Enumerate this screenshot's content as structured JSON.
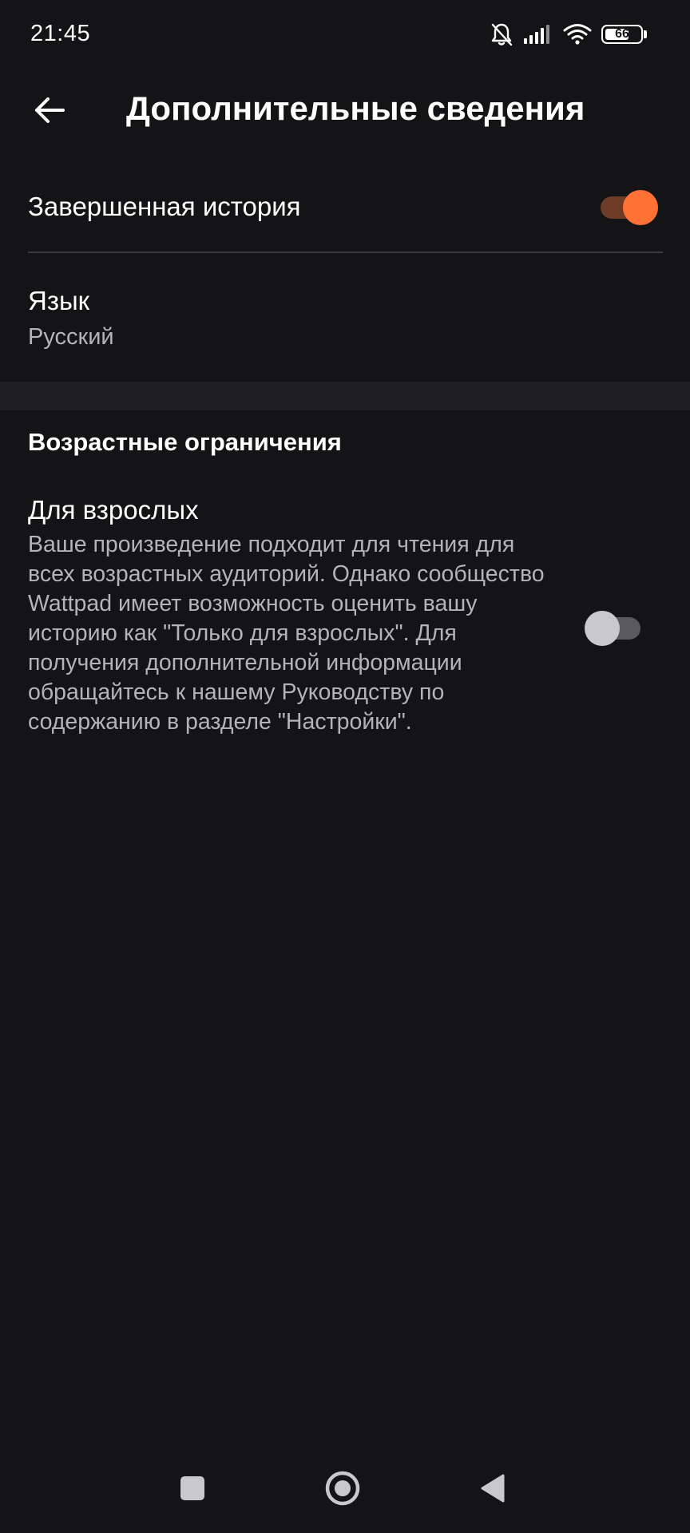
{
  "status_bar": {
    "time": "21:45",
    "icons": [
      "bell-off-icon",
      "signal-icon",
      "wifi-icon",
      "battery-icon"
    ],
    "battery_level": "66"
  },
  "toolbar": {
    "back_icon": "arrow-left-icon",
    "title": "Дополнительные сведения"
  },
  "settings": {
    "completed_story": {
      "label": "Завершенная история",
      "enabled": true
    },
    "language": {
      "label": "Язык",
      "value": "Русский"
    }
  },
  "age_section": {
    "heading": "Возрастные ограничения",
    "mature": {
      "label": "Для взрослых",
      "description": "Ваше произведение подходит для чтения для всех возрастных аудиторий. Однако сообщество Wattpad имеет возможность оценить вашу историю как \"Только для взрослых\". Для получения дополнительной информации обращайтесь к нашему Руководству по содержанию в разделе \"Настройки\".",
      "enabled": false
    }
  },
  "nav_bar": {
    "buttons": [
      "recents-square-icon",
      "home-circle-icon",
      "back-triangle-icon"
    ]
  },
  "colors": {
    "background": "#141316",
    "accent": "#ff7134",
    "accent_track": "#6e3c26",
    "secondary_text": "#b4b3b7",
    "section_gap": "#1f1e21"
  }
}
